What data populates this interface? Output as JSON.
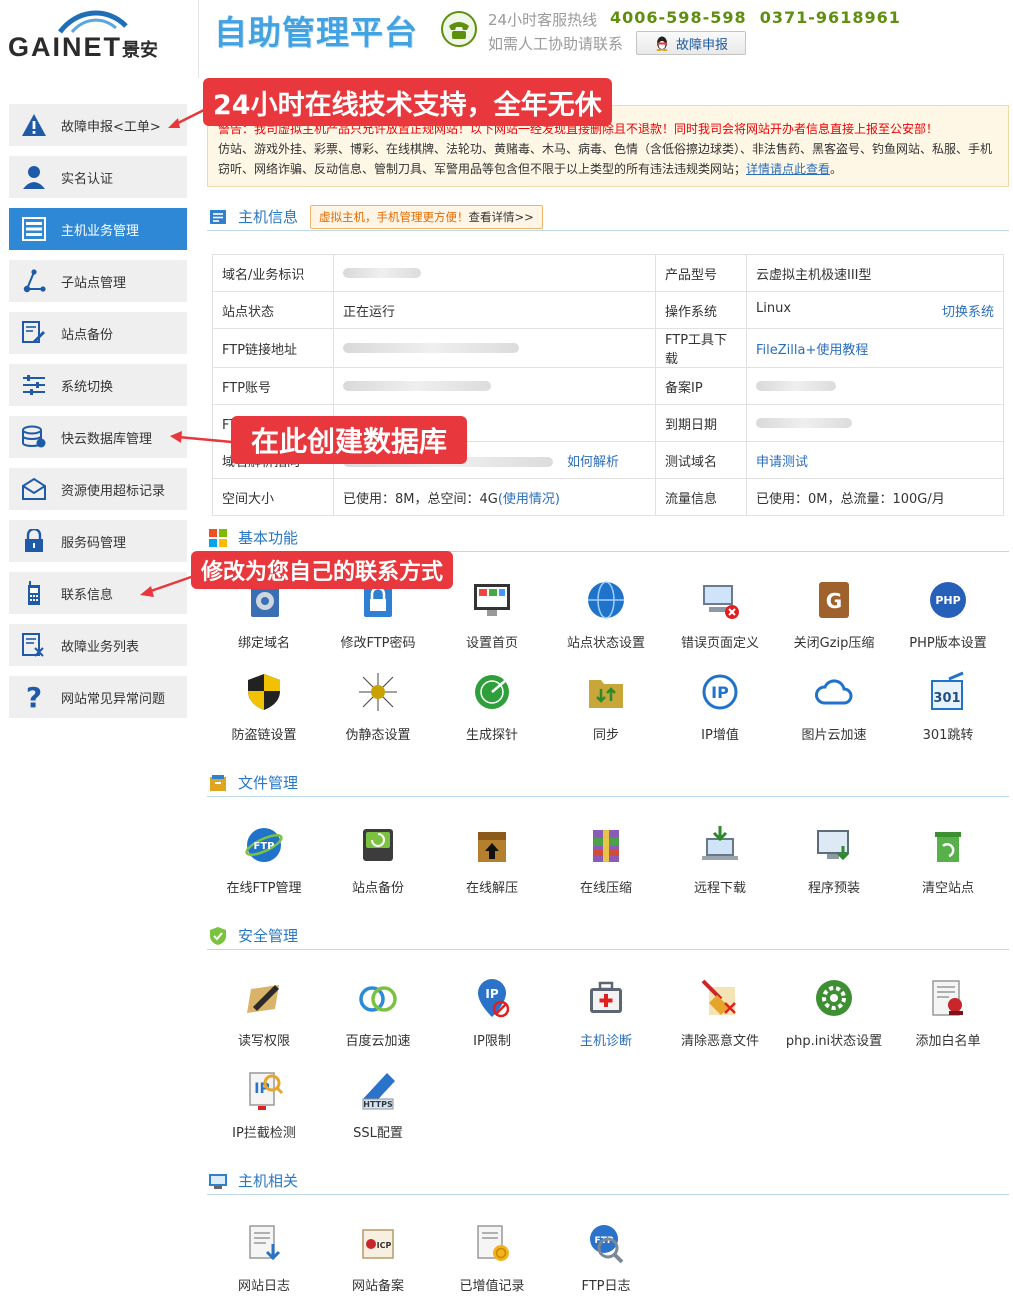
{
  "header": {
    "brand": "GAINET",
    "brand_cn": "景安",
    "title": "自助管理平台",
    "hotline_label": "24小时客服热线",
    "hotline_numbers": "4006-598-598  0371-9618961",
    "contact_label": "如需人工协助请联系",
    "fault_button": "故障申报"
  },
  "sidebar": {
    "items": [
      {
        "label": "故障申报<工单>",
        "icon": "warning-icon"
      },
      {
        "label": "实名认证",
        "icon": "user-icon"
      },
      {
        "label": "主机业务管理",
        "icon": "server-icon",
        "active": true
      },
      {
        "label": "子站点管理",
        "icon": "share-icon"
      },
      {
        "label": "站点备份",
        "icon": "backup-icon"
      },
      {
        "label": "系统切换",
        "icon": "sliders-icon"
      },
      {
        "label": "快云数据库管理",
        "icon": "database-icon"
      },
      {
        "label": "资源使用超标记录",
        "icon": "mail-icon"
      },
      {
        "label": "服务码管理",
        "icon": "lock-icon"
      },
      {
        "label": "联系信息",
        "icon": "phone-icon"
      },
      {
        "label": "故障业务列表",
        "icon": "list-icon"
      },
      {
        "label": "网站常见异常问题",
        "icon": "question-icon"
      }
    ]
  },
  "callouts": {
    "support": "24小时在线技术支持，全年无休",
    "database": "在此创建数据库",
    "contact": "修改为您自己的联系方式"
  },
  "warning": {
    "line1": "警告：我司虚拟主机产品只允许放置正规网站！以下网站一经发现直接删除且不退款！同时我司会将网站开办者信息直接上报至公安部！",
    "line2": "仿站、游戏外挂、彩票、博彩、在线棋牌、法轮功、黄赌毒、木马、病毒、色情（含低俗擦边球类）、非法售药、黑客盗号、钓鱼网站、私服、手机",
    "line3": "窃听、网络诈骗、反动信息、管制刀具、军警用品等包含但不限于以上类型的所有违法违规类网站；",
    "link": "详情请点此查看"
  },
  "host_info": {
    "title": "主机信息",
    "promo_orange": "虚拟主机，手机管理更方便！",
    "promo_dark": "查看详情>>",
    "rows": [
      {
        "k1": "域名/业务标识",
        "v1": "",
        "k2": "产品型号",
        "v2": "云虚拟主机极速III型"
      },
      {
        "k1": "站点状态",
        "v1": "正在运行",
        "k2": "操作系统",
        "v2": "Linux",
        "v2_link": "切换系统"
      },
      {
        "k1": "FTP链接地址",
        "v1": "",
        "k2": "FTP工具下载",
        "v2_link": "FileZilla+使用教程"
      },
      {
        "k1": "FTP账号",
        "v1": "",
        "k2": "备案IP",
        "v2": ""
      },
      {
        "k1": "FTP密码",
        "v1": "",
        "k2": "到期日期",
        "v2": ""
      },
      {
        "k1": "域名解析指向",
        "v1": "",
        "v1_link": "如何解析",
        "k2": "测试域名",
        "v2_link": "申请测试"
      },
      {
        "k1": "空间大小",
        "v1": "已使用：8M，总空间：4G",
        "v1_link": "(使用情况)",
        "k2": "流量信息",
        "v2": "已使用：0M，总流量：100G/月"
      }
    ]
  },
  "basic": {
    "title": "基本功能",
    "items": [
      "绑定域名",
      "修改FTP密码",
      "设置首页",
      "站点状态设置",
      "错误页面定义",
      "关闭Gzip压缩",
      "PHP版本设置",
      "防盗链设置",
      "伪静态设置",
      "生成探针",
      "同步",
      "IP增值",
      "图片云加速",
      "301跳转"
    ]
  },
  "files": {
    "title": "文件管理",
    "items": [
      "在线FTP管理",
      "站点备份",
      "在线解压",
      "在线压缩",
      "远程下载",
      "程序预装",
      "清空站点"
    ]
  },
  "security": {
    "title": "安全管理",
    "items": [
      "读写权限",
      "百度云加速",
      "IP限制",
      "主机诊断",
      "清除恶意文件",
      "php.ini状态设置",
      "添加白名单",
      "IP拦截检测",
      "SSL配置"
    ]
  },
  "related": {
    "title": "主机相关",
    "items": [
      "网站日志",
      "网站备案",
      "已增值记录",
      "FTP日志"
    ]
  },
  "colors": {
    "accent": "#2e88d6",
    "callout": "#e8383d",
    "link": "#2a6ebd",
    "hotline": "#5e8f0d"
  }
}
